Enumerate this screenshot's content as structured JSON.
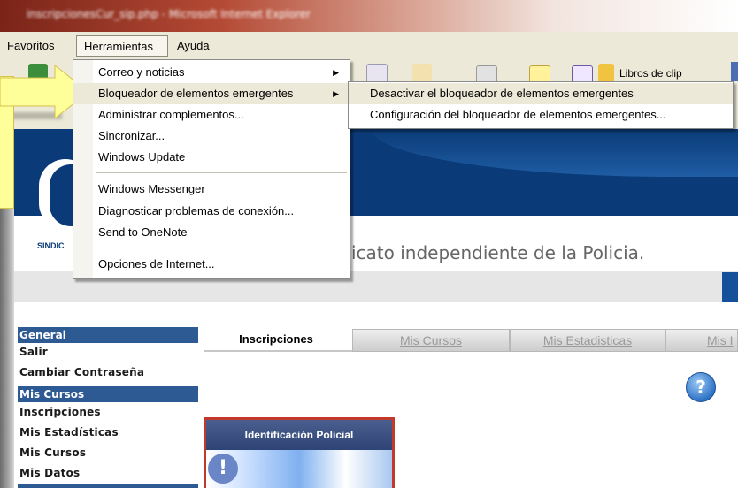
{
  "window": {
    "title": "inscripcionesCur_sip.php - Microsoft Internet Explorer"
  },
  "menubar": {
    "items": [
      "Favoritos",
      "Herramientas",
      "Ayuda"
    ]
  },
  "toolbar": {
    "links_label": "Libros de clip"
  },
  "dropdown": {
    "items": [
      {
        "label": "Correo y noticias",
        "submenu": true
      },
      {
        "label": "Bloqueador de elementos emergentes",
        "submenu": true,
        "highlighted": true
      },
      {
        "label": "Administrar complementos...",
        "submenu": false
      },
      {
        "label": "Sincronizar...",
        "submenu": false
      },
      {
        "label": "Windows Update",
        "submenu": false
      },
      {
        "label": "Windows Messenger",
        "submenu": false
      },
      {
        "label": "Diagnosticar problemas de conexión...",
        "submenu": false
      },
      {
        "label": "Send to OneNote",
        "submenu": false
      },
      {
        "label": "Opciones de Internet...",
        "submenu": false
      }
    ],
    "arrow_glyph": "▶"
  },
  "submenu": {
    "items": [
      {
        "label": "Desactivar el bloqueador de elementos emergentes",
        "highlighted": true
      },
      {
        "label": "Configuración del bloqueador de elementos emergentes..."
      }
    ]
  },
  "page": {
    "logo_caption": "SINDIC",
    "slogan": "icato independiente de la Policia.",
    "sidebar": {
      "sections": [
        {
          "header": "General",
          "items": [
            "Salir",
            "Cambiar Contraseña"
          ]
        },
        {
          "header": "Mis Cursos",
          "items": [
            "Inscripciones",
            "Mis Estadísticas",
            "Mis Cursos",
            "Mis Datos"
          ]
        }
      ]
    },
    "tabs": [
      {
        "label": "Inscripciones",
        "active": true
      },
      {
        "label": "Mis Cursos"
      },
      {
        "label": "Mis Estadisticas"
      },
      {
        "label": "Mis I"
      }
    ],
    "help_glyph": "?",
    "card": {
      "title": "Identificación Policial",
      "glyph": "!"
    }
  },
  "colors": {
    "highlight": "#ece9d8",
    "banner": "#0a3b78",
    "sidebar_header": "#2d5a93",
    "arrow_yellow": "#ffff99"
  }
}
